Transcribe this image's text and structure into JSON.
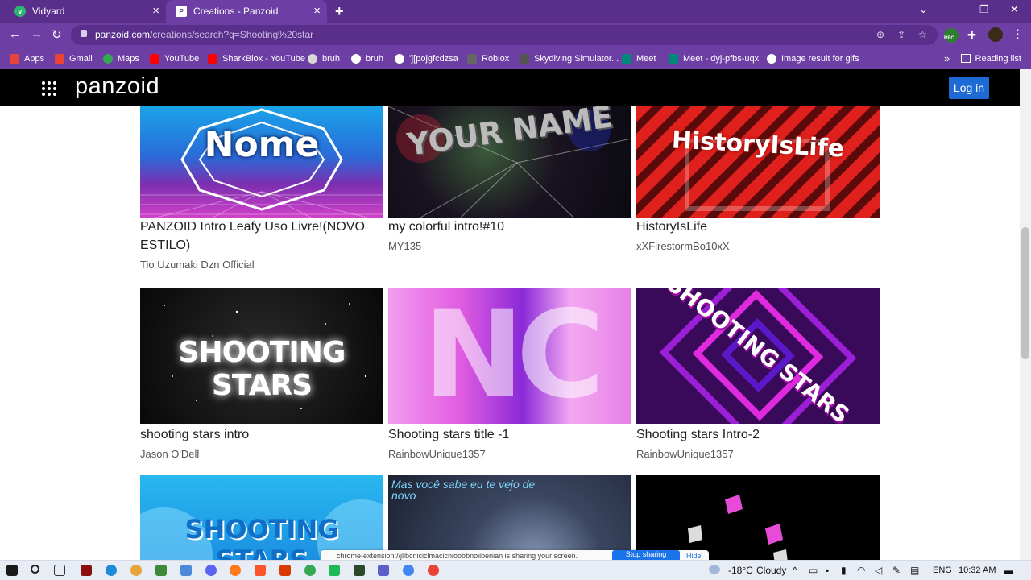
{
  "browser": {
    "tabs": [
      {
        "label": "Vidyard",
        "icon": "vidyard-icon"
      },
      {
        "label": "Creations - Panzoid",
        "icon": "panzoid-icon"
      }
    ],
    "url": {
      "host": "panzoid.com",
      "path": "/creations/search?q=Shooting%20star"
    },
    "bookmarks": [
      "Apps",
      "Gmail",
      "Maps",
      "YouTube",
      "SharkBlox - YouTube",
      "bruh",
      "bruh",
      "'][pojgfcdzsa",
      "Roblox",
      "Skydiving Simulator...",
      "Meet",
      "Meet - dyj-pfbs-uqx",
      "Image result for gifs"
    ],
    "more_bookmarks": "»",
    "reading_list": "Reading list",
    "rec_badge": "REC"
  },
  "site": {
    "logo": "panzoid",
    "login_label": "Log in"
  },
  "cards": [
    {
      "title": "PANZOID Intro Leafy Uso Livre!(NOVO ESTILO)",
      "author": "Tio Uzumaki Dzn Official",
      "thumb_text": "Nome"
    },
    {
      "title": "my colorful intro!#10",
      "author": "MY135",
      "thumb_text": "YOUR NAME"
    },
    {
      "title": "HistoryIsLife",
      "author": "xXFirestormBo10xX",
      "thumb_text": "HistoryIsLife"
    },
    {
      "title": "shooting stars intro",
      "author": "Jason O'Dell",
      "thumb_text": "SHOOTING STARS"
    },
    {
      "title": "Shooting stars title -1",
      "author": "RainbowUnique1357",
      "thumb_text": "NC"
    },
    {
      "title": "Shooting stars Intro-2",
      "author": "RainbowUnique1357",
      "thumb_text": "SHOOTING STARS"
    },
    {
      "title": "",
      "author": "",
      "thumb_text": "SHOOTING STARS"
    },
    {
      "title": "",
      "author": "",
      "thumb_text": "Mas você sabe eu te vejo de novo"
    },
    {
      "title": "",
      "author": "",
      "thumb_text": ""
    }
  ],
  "share_banner": {
    "text": "chrome-extension://jlibcniciclmacicnioobbnoiibenian is sharing your screen.",
    "stop_label": "Stop sharing",
    "hide_label": "Hide"
  },
  "taskbar": {
    "weather": "-18°C",
    "weather_desc": "Cloudy",
    "lang": "ENG",
    "time": "10:32 AM"
  },
  "colors": {
    "chrome_frame": "#5a2f8c",
    "toolbar": "#6d3fa4",
    "login_button": "#1e6bd6"
  }
}
